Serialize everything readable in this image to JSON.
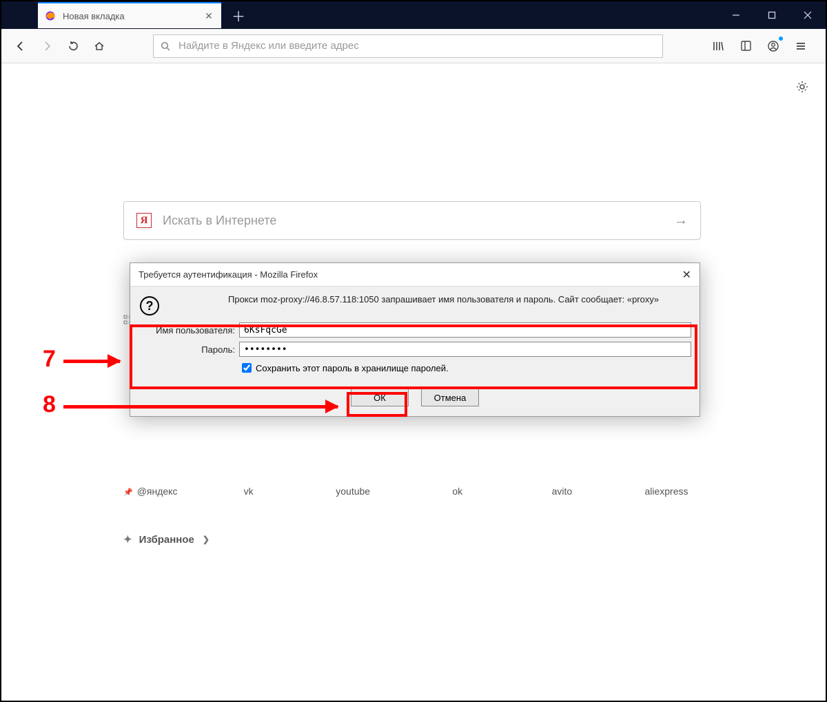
{
  "tab": {
    "title": "Новая вкладка"
  },
  "urlbar": {
    "placeholder": "Найдите в Яндекс или введите адрес"
  },
  "search": {
    "placeholder": "Искать в Интернете",
    "logo_letter": "Я"
  },
  "shortcuts": [
    "@яндекс",
    "vk",
    "youtube",
    "ok",
    "avito",
    "aliexpress"
  ],
  "favorites": {
    "label": "Избранное"
  },
  "dialog": {
    "title": "Требуется аутентификация - Mozilla Firefox",
    "message": "Прокси moz-proxy://46.8.57.118:1050 запрашивает имя пользователя и пароль. Сайт сообщает: «proxy»",
    "username_label": "Имя пользователя:",
    "username_value": "6KsFqcGe",
    "password_label": "Пароль:",
    "password_value": "••••••••",
    "save_label": "Сохранить этот пароль в хранилище паролей.",
    "ok": "ОК",
    "cancel": "Отмена"
  },
  "annotations": {
    "n7": "7",
    "n8": "8"
  }
}
